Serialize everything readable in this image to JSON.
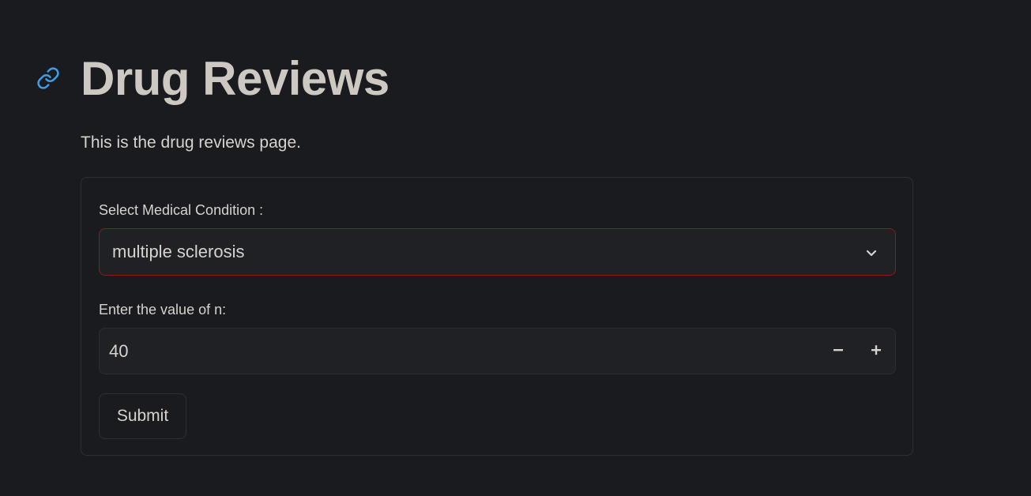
{
  "header": {
    "title": "Drug Reviews",
    "subtitle": "This is the drug reviews page.",
    "anchor_icon": "link-icon"
  },
  "form": {
    "condition": {
      "label": "Select Medical Condition :",
      "value": "multiple sclerosis",
      "icon": "chevron-down-icon"
    },
    "n_value": {
      "label": "Enter the value of n:",
      "value": "40",
      "minus_icon": "minus-icon",
      "plus_icon": "plus-icon"
    },
    "submit_label": "Submit"
  },
  "colors": {
    "background": "#1a1b1e",
    "text": "#d6d3cf",
    "link_icon": "#3b9ee8",
    "select_border_focus": "#8e1b1b",
    "input_background": "#202124"
  }
}
